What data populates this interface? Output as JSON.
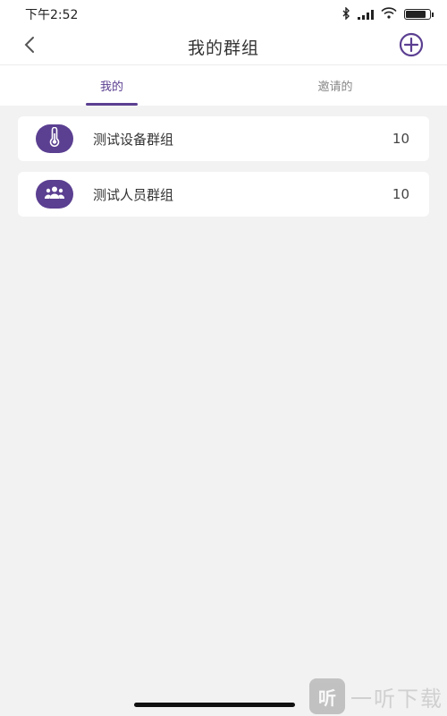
{
  "status_bar": {
    "time": "下午2:52",
    "battery_level": 0.8
  },
  "header": {
    "title": "我的群组",
    "back_icon": "chevron-left-icon",
    "add_icon": "plus-circle-icon"
  },
  "tabs": [
    {
      "label": "我的",
      "active": true
    },
    {
      "label": "邀请的",
      "active": false
    }
  ],
  "groups": [
    {
      "name": "测试设备群组",
      "count": "10",
      "icon": "thermometer-icon"
    },
    {
      "name": "测试人员群组",
      "count": "10",
      "icon": "people-icon"
    }
  ],
  "watermark": {
    "badge": "听",
    "text": "一听下载"
  },
  "colors": {
    "accent": "#5b3f91",
    "background": "#f2f2f2"
  }
}
